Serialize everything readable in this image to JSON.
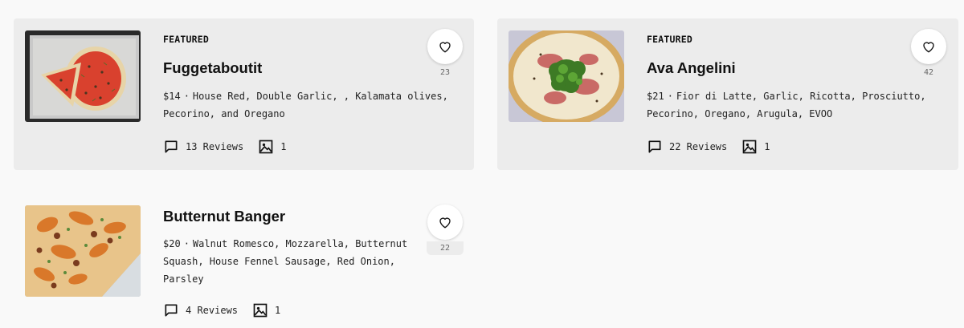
{
  "items": [
    {
      "tag": "FEATURED",
      "name": "Fuggetaboutit",
      "price": "$14",
      "separator": "·",
      "ingredients": "House Red, Double Garlic, , Kalamata olives, Pecorino, and Oregano",
      "likes": "23",
      "reviews": "13 Reviews",
      "photos": "1"
    },
    {
      "tag": "FEATURED",
      "name": "Ava Angelini",
      "price": "$21",
      "separator": "·",
      "ingredients": "Fior di Latte, Garlic, Ricotta, Prosciutto, Pecorino, Oregano, Arugula, EVOO",
      "likes": "42",
      "reviews": "22 Reviews",
      "photos": "1"
    },
    {
      "name": "Butternut Banger",
      "price": "$20",
      "separator": "·",
      "ingredients": "Walnut Romesco, Mozzarella, Butternut Squash, House Fennel Sausage, Red Onion, Parsley",
      "likes": "22",
      "reviews": "4 Reviews",
      "photos": "1"
    }
  ],
  "icons": {
    "heart": "heart-icon",
    "reviews": "comment-icon",
    "photos": "image-icon"
  },
  "colors": {
    "featured_bg": "#ececec",
    "page_bg": "#f9f9f9"
  }
}
